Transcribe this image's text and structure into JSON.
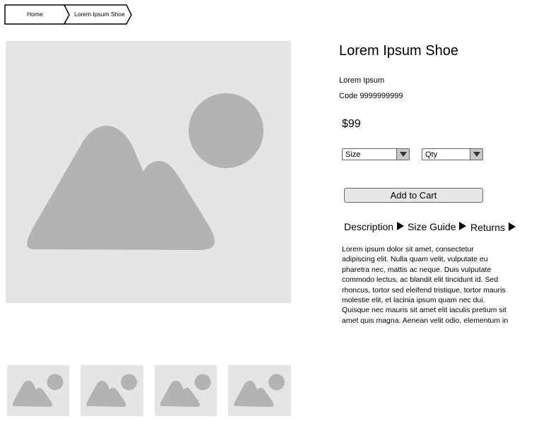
{
  "breadcrumb": {
    "items": [
      {
        "label": "Home"
      },
      {
        "label": "Lorem Ipsum Shoe"
      }
    ]
  },
  "product": {
    "title": "Lorem Ipsum Shoe",
    "brand": "Lorem Ipsum",
    "code": "Code 9999999999",
    "price": "$99",
    "size_select": {
      "value": "Size"
    },
    "qty_select": {
      "value": "Qty"
    },
    "add_to_cart_label": "Add to Cart",
    "tabs": [
      {
        "label": "Description"
      },
      {
        "label": "Size Guide"
      },
      {
        "label": "Returns"
      }
    ],
    "description": "Lorem ipsum dolor sit amet, consectetur\nadipiscing elit. Nulla quam velit, vulputate eu\npharetra nec, mattis ac neque. Duis vulputate\ncommodo lectus, ac blandit elit tincidunt id. Sed\nrhoncus, tortor sed eleifend tristique, tortor mauris\nmolestie elit, et lacinia ipsum quam nec dui.\nQuisque nec mauris sit amet elit iaculis pretium sit\namet quis magna. Aenean velit odio, elementum in"
  },
  "colors": {
    "placeholder_bg": "#e5e5e5",
    "placeholder_shape": "#b3b3b3",
    "border": "#666666"
  }
}
